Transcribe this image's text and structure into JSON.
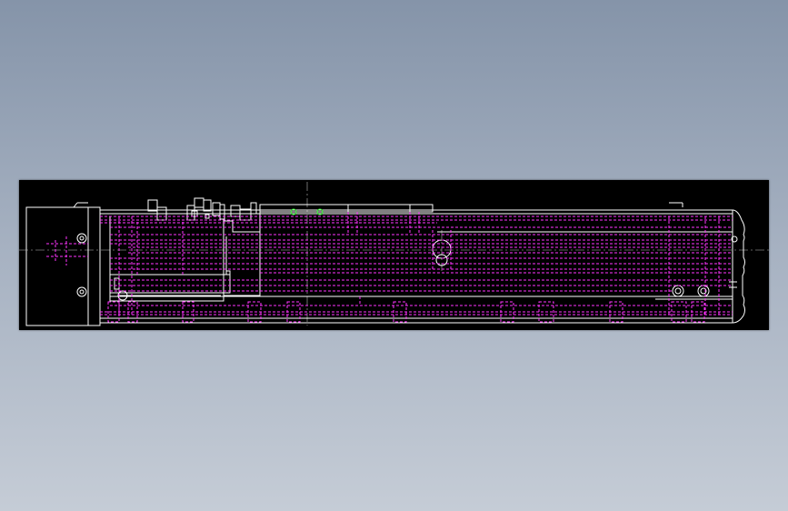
{
  "drawing": {
    "background": "#000000",
    "colors": {
      "outline": "#ffffff",
      "hidden_lines": "#ff33ff",
      "center_lines": "#bbbbbb",
      "highlight_points": "#33ff33"
    },
    "parts": [
      "motor-block",
      "end-plate",
      "carriage",
      "rail-body",
      "end-cap",
      "mounting-feet",
      "bolt-holes"
    ]
  }
}
